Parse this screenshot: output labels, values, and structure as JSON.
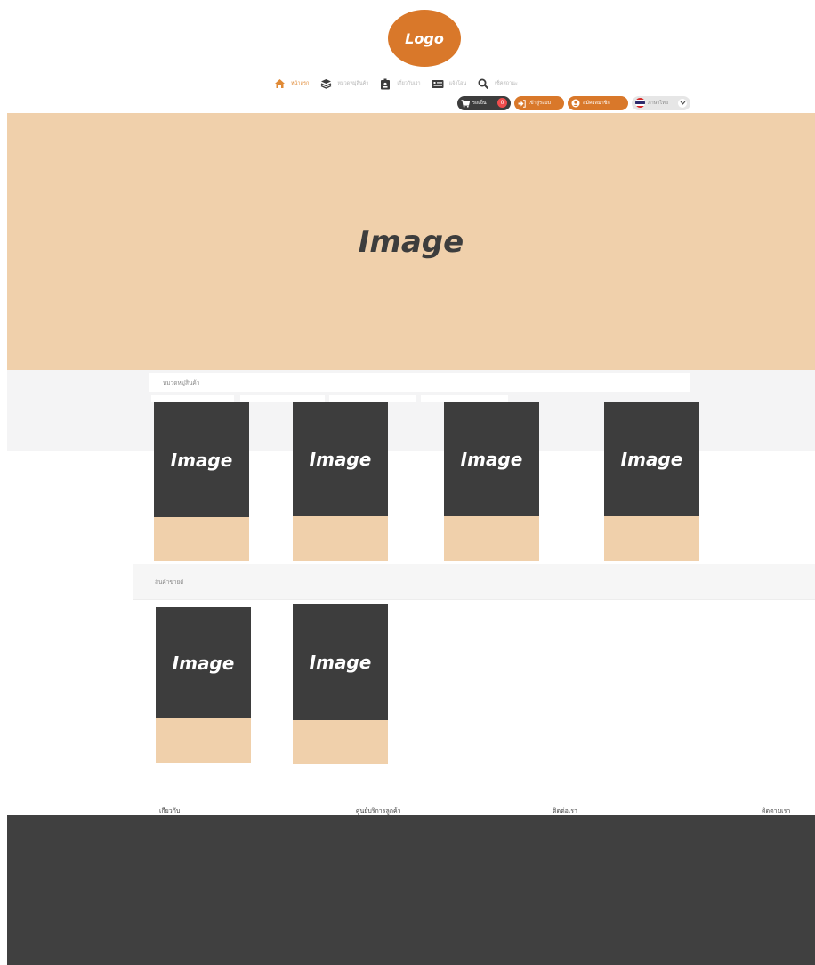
{
  "header": {
    "logo_text": "Logo"
  },
  "nav": {
    "items": [
      {
        "label": "หน้าแรก",
        "icon": "home-icon",
        "active": true
      },
      {
        "label": "หมวดหมู่สินค้า",
        "icon": "layers-icon",
        "active": false
      },
      {
        "label": "เกี่ยวกับเรา",
        "icon": "id-badge-icon",
        "active": false
      },
      {
        "label": "แจ้งโอน",
        "icon": "money-transfer-icon",
        "active": false
      },
      {
        "label": "เช็คสถานะ",
        "icon": "search-icon",
        "active": false
      }
    ]
  },
  "actions": {
    "cart_label": "รถเข็น",
    "cart_count": "0",
    "login_label": "เข้าสู่ระบบ",
    "register_label": "สมัครสมาชิก",
    "language_label": "ภาษาไทย"
  },
  "hero": {
    "placeholder": "Image"
  },
  "categories": {
    "title": "หมวดหมู่สินค้า",
    "items": [
      {
        "placeholder": "Image"
      },
      {
        "placeholder": "Image"
      },
      {
        "placeholder": "Image"
      },
      {
        "placeholder": "Image"
      }
    ]
  },
  "best_sellers": {
    "title": "สินค้าขายดี",
    "items": [
      {
        "placeholder": "Image"
      },
      {
        "placeholder": "Image"
      }
    ]
  },
  "footer": {
    "columns": [
      "เกี่ยวกับ",
      "ศูนย์บริการลูกค้า",
      "ติดต่อเรา",
      "ติดตามเรา"
    ]
  },
  "colors": {
    "brand_orange": "#d9782a",
    "peach": "#f0d0ab",
    "dark": "#3d3d3d",
    "badge_red": "#ef4d4d"
  }
}
